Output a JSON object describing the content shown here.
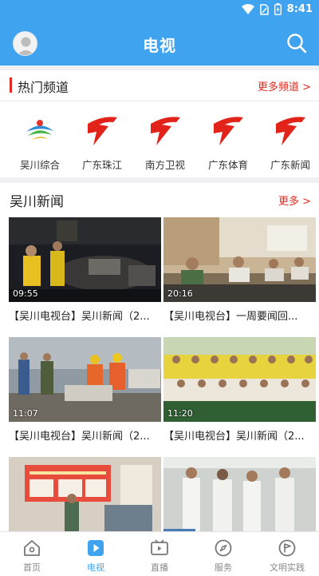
{
  "status_bar": {
    "time": "8:41"
  },
  "header": {
    "title": "电视"
  },
  "hot_channels": {
    "title": "热门频道",
    "more": "更多频道 >",
    "items": [
      {
        "label": "吴川综合"
      },
      {
        "label": "广东珠江"
      },
      {
        "label": "南方卫视"
      },
      {
        "label": "广东体育"
      },
      {
        "label": "广东新闻"
      }
    ]
  },
  "news": {
    "title": "吴川新闻",
    "more": "更多 >",
    "videos": [
      {
        "duration": "09:55",
        "caption": "【吴川电视台】吴川新闻（2..."
      },
      {
        "duration": "20:16",
        "caption": "【吴川电视台】一周要闻回..."
      },
      {
        "duration": "11:07",
        "caption": "【吴川电视台】吴川新闻（2..."
      },
      {
        "duration": "11:20",
        "caption": "【吴川电视台】吴川新闻（2..."
      },
      {
        "duration": "",
        "caption": ""
      },
      {
        "duration": "",
        "caption": ""
      }
    ]
  },
  "tabs": [
    {
      "label": "首页",
      "icon": "home-icon",
      "active": false
    },
    {
      "label": "电视",
      "icon": "tv-play-icon",
      "active": true
    },
    {
      "label": "直播",
      "icon": "live-video-icon",
      "active": false
    },
    {
      "label": "服务",
      "icon": "compass-icon",
      "active": false
    },
    {
      "label": "文明实践",
      "icon": "flag-icon",
      "active": false
    }
  ],
  "colors": {
    "primary": "#3fa3f0",
    "accent": "#e12a20"
  }
}
